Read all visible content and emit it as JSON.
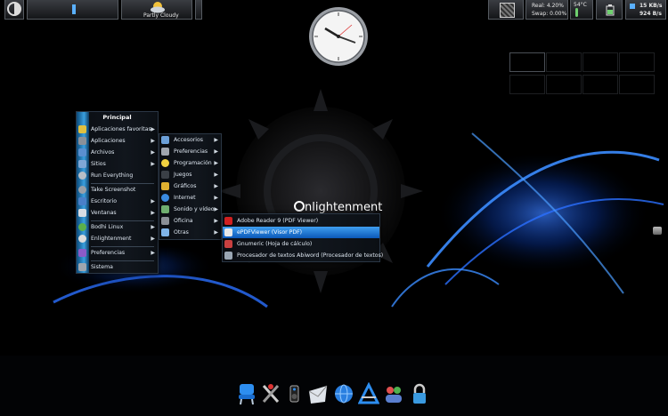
{
  "shelf": {
    "weather_label": "Partly Cloudy",
    "mem_real": "Real: 4.20%",
    "mem_swap": "Swap: 0.00%",
    "temperature": "54°C",
    "net_down": "15 KB/s",
    "net_up": "924 B/s"
  },
  "brand": "nlightenment",
  "menu_main": {
    "title": "Principal",
    "items": [
      {
        "label": "Aplicaciones favoritas"
      },
      {
        "label": "Aplicaciones"
      },
      {
        "label": "Archivos"
      },
      {
        "label": "Sitios"
      },
      {
        "label": "Run Everything"
      },
      {
        "label": "Take Screenshot"
      },
      {
        "label": "Escritorio"
      },
      {
        "label": "Ventanas"
      },
      {
        "label": "Bodhi Linux"
      },
      {
        "label": "Enlightenment"
      },
      {
        "label": "Preferencias"
      },
      {
        "label": "Sistema"
      }
    ]
  },
  "menu_apps": {
    "items": [
      {
        "label": "Accesorios"
      },
      {
        "label": "Preferencias"
      },
      {
        "label": "Programación"
      },
      {
        "label": "Juegos"
      },
      {
        "label": "Gráficos"
      },
      {
        "label": "Internet"
      },
      {
        "label": "Sonido y vídeo"
      },
      {
        "label": "Oficina"
      },
      {
        "label": "Otras"
      }
    ]
  },
  "menu_office": {
    "items": [
      {
        "label": "Adobe Reader 9 (PDF Viewer)"
      },
      {
        "label": "ePDFViewer (Visor PDF)"
      },
      {
        "label": "Gnumeric (Hoja de cálculo)"
      },
      {
        "label": "Procesador de textos Abiword (Procesador de textos)"
      }
    ]
  },
  "colors": {
    "accent": "#1f7fe0",
    "rail": "#3aa0e0",
    "background": "#000000"
  }
}
